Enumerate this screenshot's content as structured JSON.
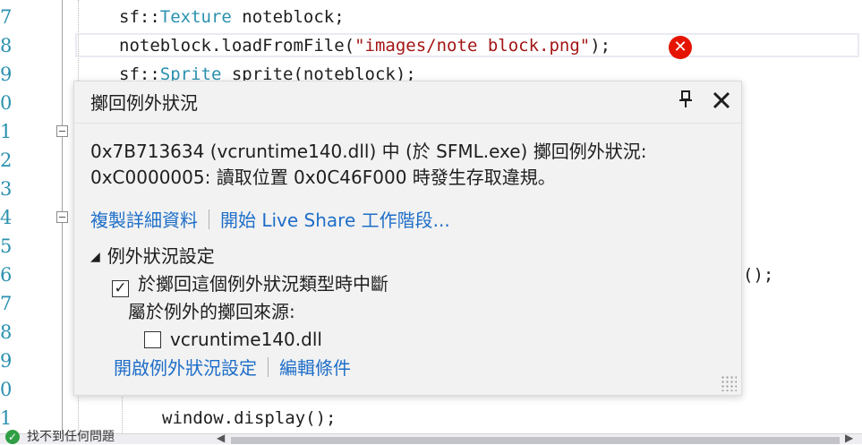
{
  "editor": {
    "line_numbers": [
      "7",
      "8",
      "9",
      "0",
      "1",
      "2",
      "3",
      "4",
      "5",
      "6",
      "7",
      "8",
      "9",
      "0",
      "1"
    ],
    "code": {
      "line1": {
        "ns": "sf::",
        "type": "Texture",
        "rest": " noteblock;"
      },
      "line2": {
        "call": "noteblock.loadFromFile(",
        "str": "\"images/note block.png\"",
        "end": ");"
      },
      "line3": {
        "ns": "sf::",
        "type": "Sprite",
        "rest": " sprite(noteblock);"
      },
      "partial_right": "();",
      "display_line": "window.display();"
    },
    "error_icon": "error-x-icon"
  },
  "exception_popup": {
    "title": "擲回例外狀況",
    "pin_icon": "pin-icon",
    "close_icon": "close-icon",
    "message_line1": "0x7B713634 (vcruntime140.dll) 中 (於 SFML.exe) 擲回例外狀況:",
    "message_line2": "0xC0000005: 讀取位置 0x0C46F000 時發生存取違規。",
    "links": {
      "copy_details": "複製詳細資料",
      "live_share": "開始 Live Share 工作階段..."
    },
    "settings": {
      "header": "例外狀況設定",
      "break_when_thrown": {
        "label": "於擲回這個例外狀況類型時中斷",
        "checked": true
      },
      "except_label": "屬於例外的擲回來源:",
      "source_module": {
        "label": "vcruntime140.dll",
        "checked": false
      }
    },
    "footer_links": {
      "open_settings": "開啟例外狀況設定",
      "edit_conditions": "編輯條件"
    }
  },
  "status_bar": {
    "text": "找不到任何問題",
    "ok_icon": "check-circle-icon"
  },
  "colors": {
    "link": "#1e6ec8",
    "error": "#e51400",
    "type": "#2b91af",
    "string": "#a31515",
    "line_number": "#2b91af"
  }
}
